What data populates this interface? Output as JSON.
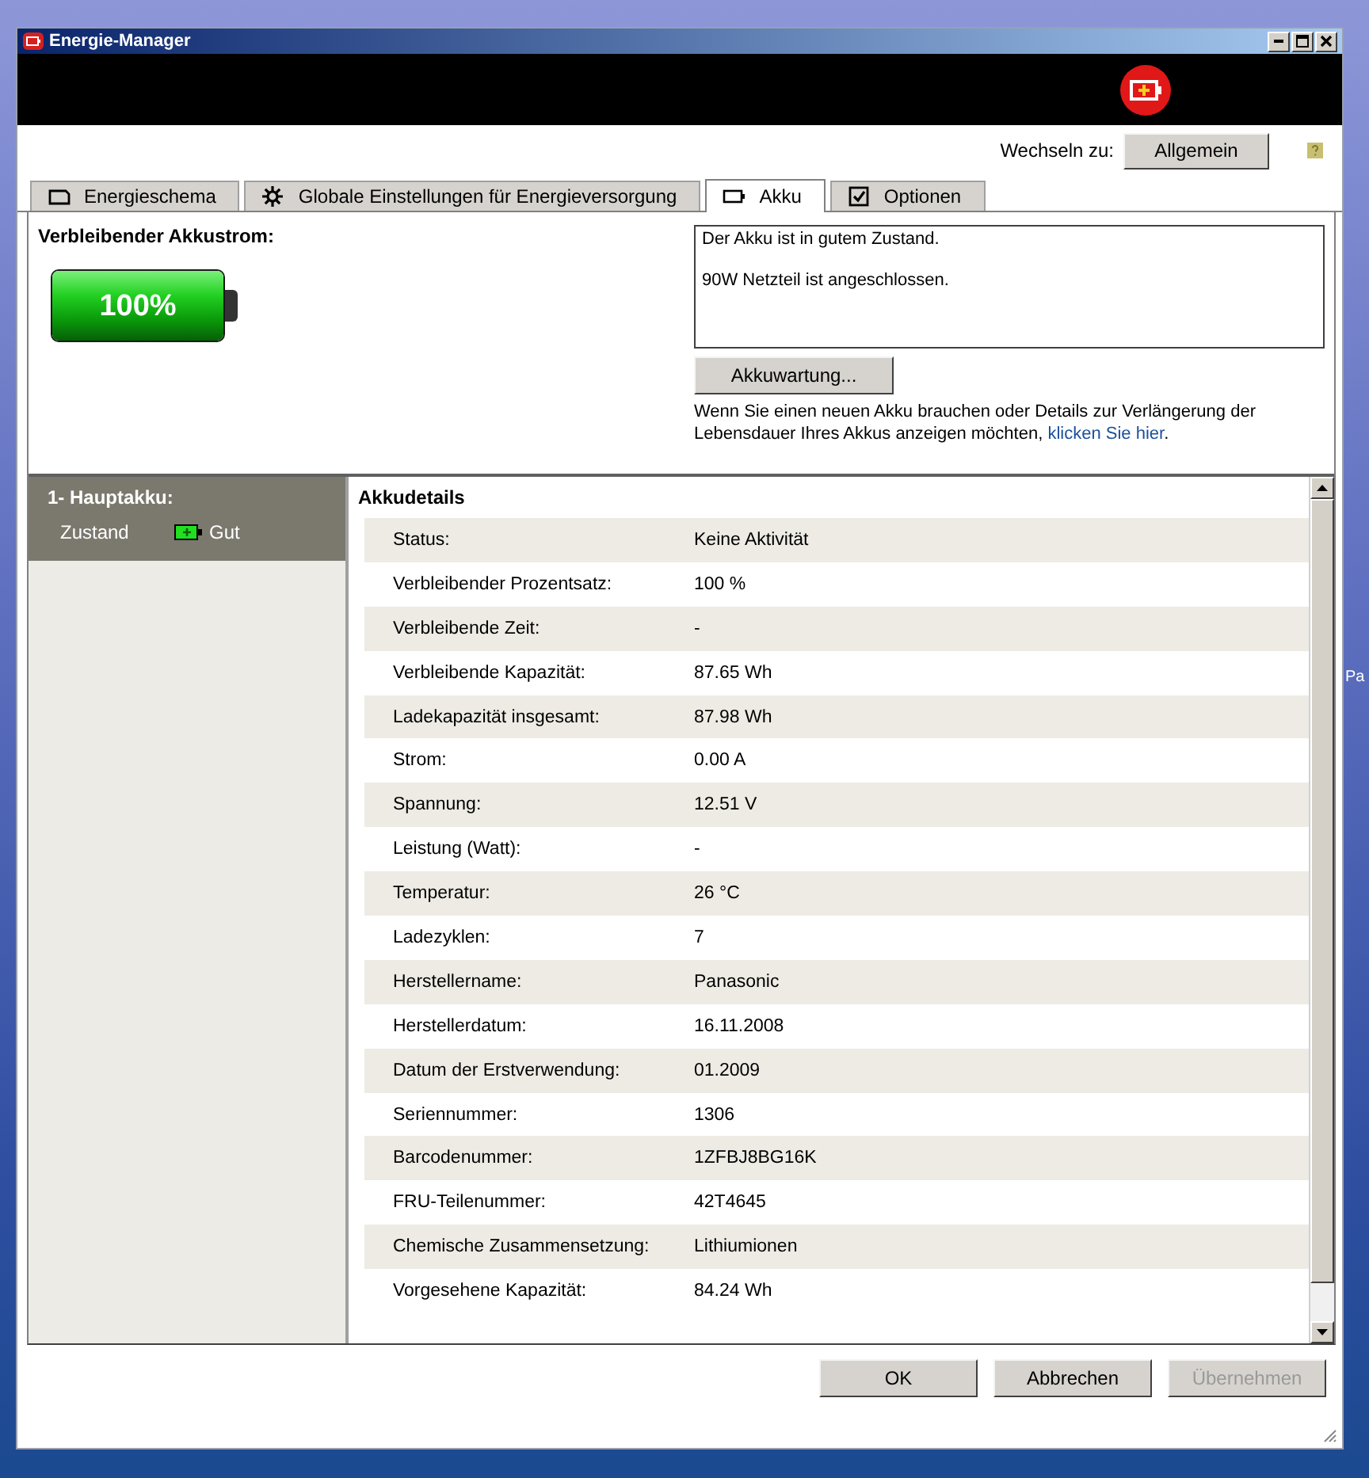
{
  "window": {
    "title": "Energie-Manager"
  },
  "switch_to": {
    "label": "Wechseln zu:",
    "button": "Allgemein"
  },
  "tabs": [
    {
      "label": "Energieschema",
      "selected": false
    },
    {
      "label": "Globale Einstellungen für Energieversorgung",
      "selected": false
    },
    {
      "label": "Akku",
      "selected": true
    },
    {
      "label": "Optionen",
      "selected": false
    }
  ],
  "remaining": {
    "label": "Verbleibender Akkustrom:",
    "percent": "100%",
    "level": 1
  },
  "status_box": [
    "Der Akku ist in gutem Zustand.",
    "90W Netzteil ist angeschlossen."
  ],
  "maintenance_button": "Akkuwartung...",
  "hint": {
    "text": "Wenn Sie einen neuen Akku brauchen oder Details zur Verlängerung der Lebensdauer Ihres Akkus anzeigen möchten, ",
    "link": "klicken Sie hier",
    "end": "."
  },
  "battery_list": [
    {
      "title": "1- Hauptakku:",
      "state_label": "Zustand",
      "state": "Gut",
      "selected": true
    }
  ],
  "details": {
    "title": "Akkudetails",
    "rows": [
      {
        "label": "Status:",
        "value": "Keine Aktivität"
      },
      {
        "label": "Verbleibender Prozentsatz:",
        "value": "100 %"
      },
      {
        "label": "Verbleibende Zeit:",
        "value": "-"
      },
      {
        "label": "Verbleibende Kapazität:",
        "value": "87.65 Wh"
      },
      {
        "label": "Ladekapazität insgesamt:",
        "value": "87.98 Wh"
      },
      {
        "label": "Strom:",
        "value": "0.00 A"
      },
      {
        "label": "Spannung:",
        "value": "12.51 V"
      },
      {
        "label": "Leistung (Watt):",
        "value": "-"
      },
      {
        "label": "Temperatur:",
        "value": "26 °C"
      },
      {
        "label": "Ladezyklen:",
        "value": "7"
      },
      {
        "label": "Herstellername:",
        "value": "Panasonic"
      },
      {
        "label": "Herstellerdatum:",
        "value": "16.11.2008"
      },
      {
        "label": "Datum der Erstverwendung:",
        "value": "01.2009"
      },
      {
        "label": "Seriennummer:",
        "value": "1306"
      },
      {
        "label": "Barcodenummer:",
        "value": "1ZFBJ8BG16K"
      },
      {
        "label": "FRU-Teilenummer:",
        "value": "42T4645"
      },
      {
        "label": "Chemische Zusammensetzung:",
        "value": "Lithiumionen"
      },
      {
        "label": "Vorgesehene Kapazität:",
        "value": "84.24 Wh"
      }
    ]
  },
  "buttons": [
    {
      "label": "OK",
      "disabled": false
    },
    {
      "label": "Abbrechen",
      "disabled": false
    },
    {
      "label": "Übernehmen",
      "disabled": true
    }
  ],
  "desktop_label": "Pa"
}
